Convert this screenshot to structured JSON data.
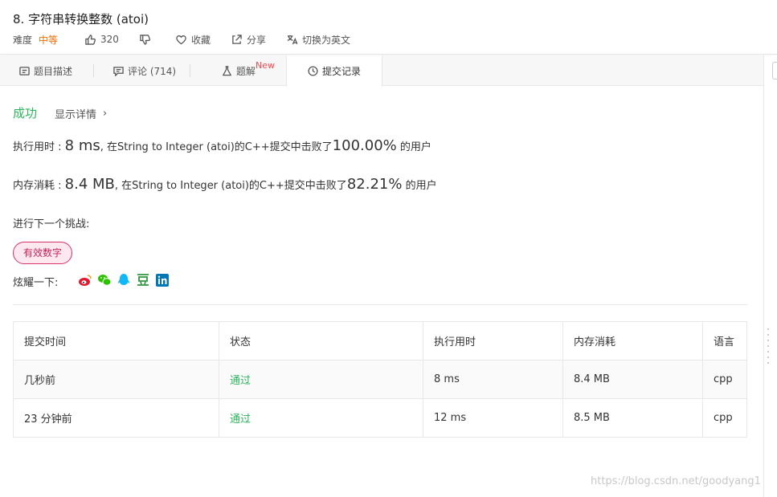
{
  "problem": {
    "title": "8. 字符串转换整数 (atoi)",
    "difficulty_label": "难度",
    "difficulty_value": "中等",
    "likes": "320",
    "favorite_label": "收藏",
    "share_label": "分享",
    "switch_lang_label": "切换为英文"
  },
  "tabs": {
    "description": "题目描述",
    "comments": "评论 (714)",
    "solutions": "题解",
    "solutions_badge": "New",
    "submissions": "提交记录"
  },
  "result": {
    "status": "成功",
    "details_link": "显示详情",
    "chevron": "›",
    "runtime_prefix": "执行用时 : ",
    "runtime_value": "8 ms",
    "runtime_mid": ", 在String to Integer (atoi)的C++提交中击败了",
    "runtime_percent": "100.00%",
    "runtime_suffix": " 的用户",
    "memory_prefix": "内存消耗 : ",
    "memory_value": "8.4 MB",
    "memory_mid": ", 在String to Integer (atoi)的C++提交中击败了",
    "memory_percent": "82.21%",
    "memory_suffix": " 的用户",
    "next_challenge_label": "进行下一个挑战:",
    "next_challenge_tag": "有效数字",
    "share_label": "炫耀一下:"
  },
  "share_icons": [
    "weibo-icon",
    "wechat-icon",
    "qq-icon",
    "douban-icon",
    "linkedin-icon"
  ],
  "colors": {
    "success": "#2db55d",
    "medium": "#ef6c00",
    "tag": "#c2255c"
  },
  "table": {
    "headers": [
      "提交时间",
      "状态",
      "执行用时",
      "内存消耗",
      "语言"
    ],
    "rows": [
      [
        "几秒前",
        "通过",
        "8 ms",
        "8.4 MB",
        "cpp"
      ],
      [
        "23 分钟前",
        "通过",
        "12 ms",
        "8.5 MB",
        "cpp"
      ]
    ]
  },
  "watermark": "https://blog.csdn.net/goodyang1"
}
